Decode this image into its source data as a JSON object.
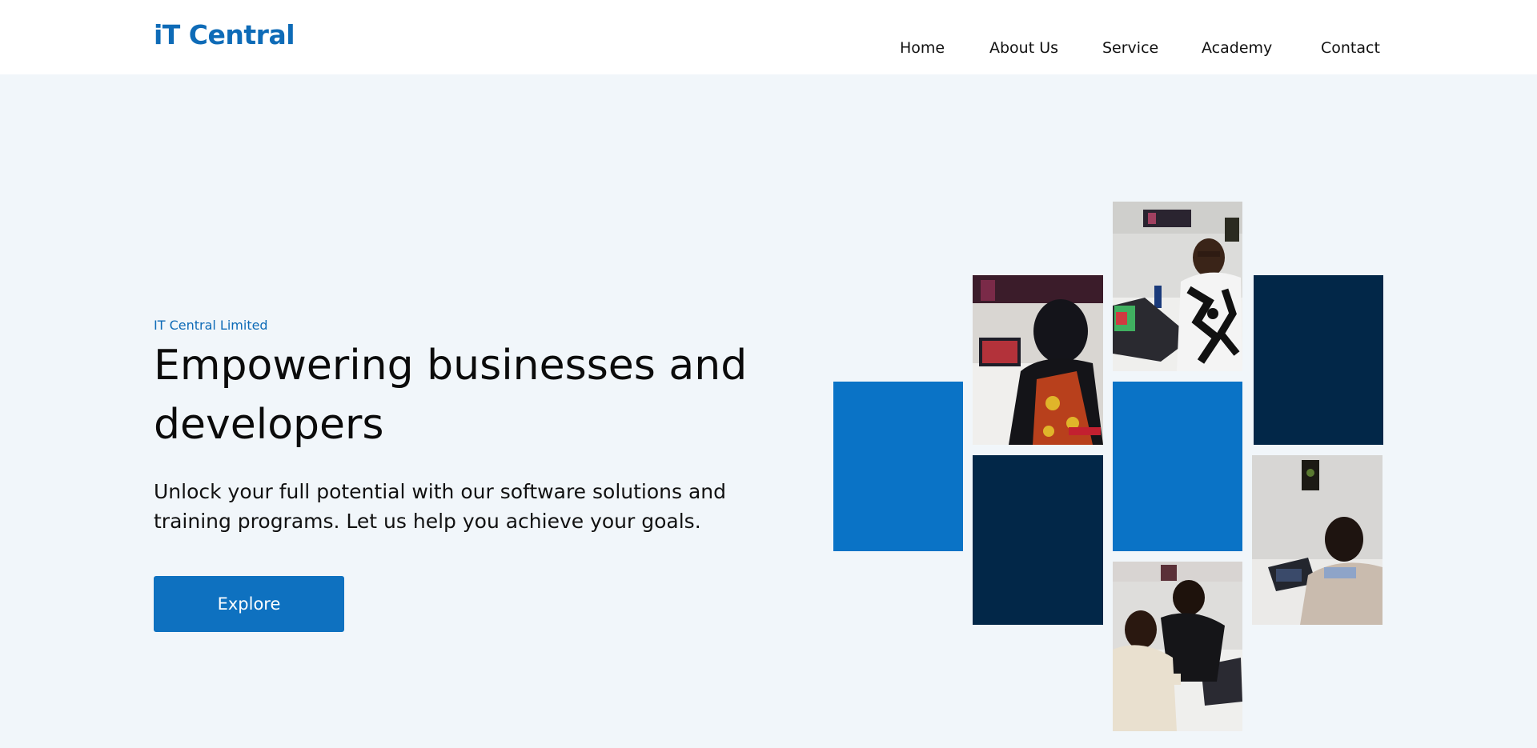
{
  "brand": {
    "logo_text": "iT Central",
    "accent_color": "#0e6bb7"
  },
  "nav": {
    "items": [
      {
        "label": "Home"
      },
      {
        "label": "About Us"
      },
      {
        "label": "Service"
      },
      {
        "label": "Academy"
      },
      {
        "label": "Contact"
      }
    ]
  },
  "hero": {
    "eyebrow": "IT Central Limited",
    "headline": "Empowering businesses and developers",
    "subtext": "Unlock your full potential with our software solutions and training programs. Let us help you achieve your goals.",
    "cta_label": "Explore"
  },
  "collage": {
    "colors": {
      "blue": "#0a73c6",
      "navy": "#022748"
    },
    "tiles": [
      {
        "kind": "color-block",
        "color": "blue"
      },
      {
        "kind": "photo",
        "subject": "woman in headscarf working on laptop"
      },
      {
        "kind": "color-block",
        "color": "navy"
      },
      {
        "kind": "photo",
        "subject": "man typing on laptop at desk"
      },
      {
        "kind": "color-block",
        "color": "blue"
      },
      {
        "kind": "photo",
        "subject": "two men looking at laptop"
      },
      {
        "kind": "color-block",
        "color": "navy"
      },
      {
        "kind": "photo",
        "subject": "man seated with laptop"
      }
    ]
  }
}
